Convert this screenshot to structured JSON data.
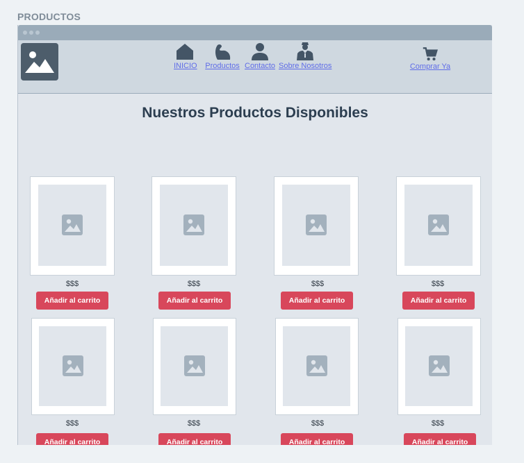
{
  "page_label": "PRODUCTOS",
  "nav": {
    "items": [
      {
        "label": "INICIO",
        "icon": "home-icon"
      },
      {
        "label": "Productos",
        "icon": "flexed-arm-icon"
      },
      {
        "label": "Contacto",
        "icon": "user-icon"
      },
      {
        "label": "Sobre Nosotros",
        "icon": "employee-icon"
      }
    ],
    "cart": {
      "label": "Comprar Ya",
      "icon": "shopping-cart-icon"
    }
  },
  "main": {
    "title": "Nuestros Productos Disponibles",
    "products": [
      {
        "price": "$$$",
        "button": "Añadir al carrito"
      },
      {
        "price": "$$$",
        "button": "Añadir al carrito"
      },
      {
        "price": "$$$",
        "button": "Añadir al carrito"
      },
      {
        "price": "$$$",
        "button": "Añadir al carrito"
      },
      {
        "price": "$$$",
        "button": "Añadir al carrito"
      },
      {
        "price": "$$$",
        "button": "Añadir al carrito"
      },
      {
        "price": "$$$",
        "button": "Añadir al carrito"
      },
      {
        "price": "$$$",
        "button": "Añadir al carrito"
      }
    ]
  },
  "colors": {
    "accent_button": "#d8475b",
    "link": "#5f6ce8",
    "heading": "#2c3e50"
  }
}
